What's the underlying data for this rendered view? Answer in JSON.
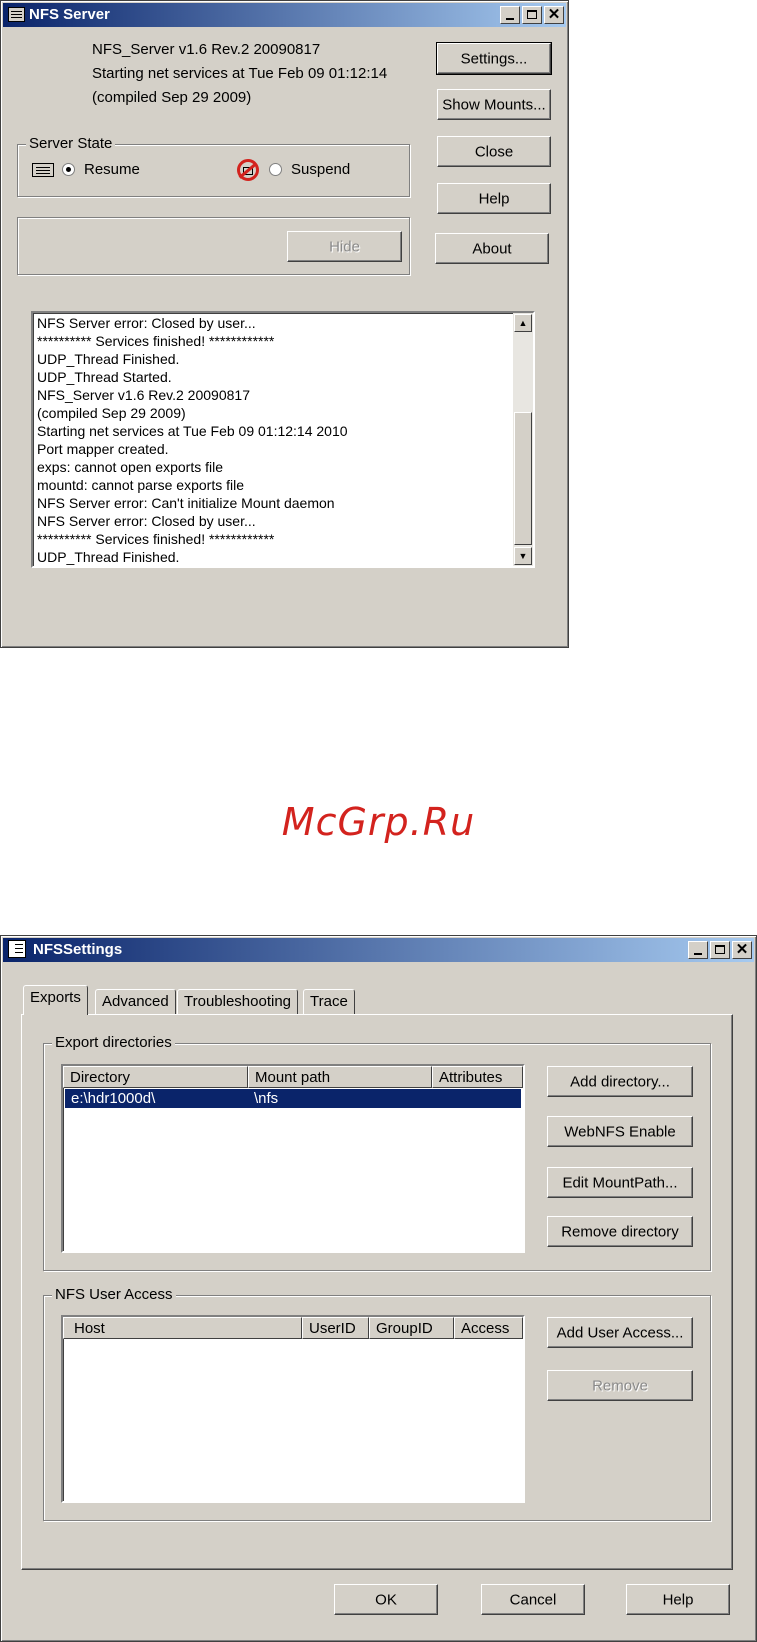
{
  "nfs_server": {
    "title": "NFS Server",
    "info_lines": [
      "NFS_Server v1.6 Rev.2 20090817",
      "Starting net services at Tue Feb 09 01:12:14",
      "(compiled Sep 29 2009)"
    ],
    "server_state_label": "Server State",
    "resume_label": "Resume",
    "suspend_label": "Suspend",
    "resume_selected": true,
    "hide_label": "Hide",
    "buttons": {
      "settings": "Settings...",
      "show_mounts": "Show Mounts...",
      "close": "Close",
      "help": "Help",
      "about": "About"
    },
    "log": [
      "NFS Server error: Closed by user...",
      "********** Services finished! ************",
      "UDP_Thread Finished.",
      "UDP_Thread Started.",
      "NFS_Server v1.6 Rev.2 20090817",
      "(compiled Sep 29 2009)",
      "Starting net services at Tue Feb 09 01:12:14 2010",
      " Port mapper created.",
      "exps: cannot open exports file",
      "mountd: cannot parse exports file",
      "NFS Server error: Can't initialize Mount daemon",
      "NFS Server error: Closed by user...",
      "********** Services finished! ************",
      "UDP_Thread Finished."
    ]
  },
  "watermark": "McGrp.Ru",
  "nfs_settings": {
    "title": "NFSSettings",
    "tabs": [
      "Exports",
      "Advanced",
      "Troubleshooting",
      "Trace"
    ],
    "active_tab": "Exports",
    "export_group_label": "Export directories",
    "export_columns": [
      "Directory",
      "Mount path",
      "Attributes"
    ],
    "export_rows": [
      {
        "directory": "e:\\hdr1000d\\",
        "mount_path": "\\nfs",
        "attributes": ""
      }
    ],
    "export_buttons": {
      "add_directory": "Add directory...",
      "webnfs_enable": "WebNFS Enable",
      "edit_mountpath": "Edit MountPath...",
      "remove_directory": "Remove directory"
    },
    "user_group_label": "NFS User Access",
    "user_columns": [
      "Host",
      "UserID",
      "GroupID",
      "Access"
    ],
    "user_buttons": {
      "add_user_access": "Add User Access...",
      "remove": "Remove"
    },
    "footer_buttons": {
      "ok": "OK",
      "cancel": "Cancel",
      "help": "Help"
    }
  }
}
